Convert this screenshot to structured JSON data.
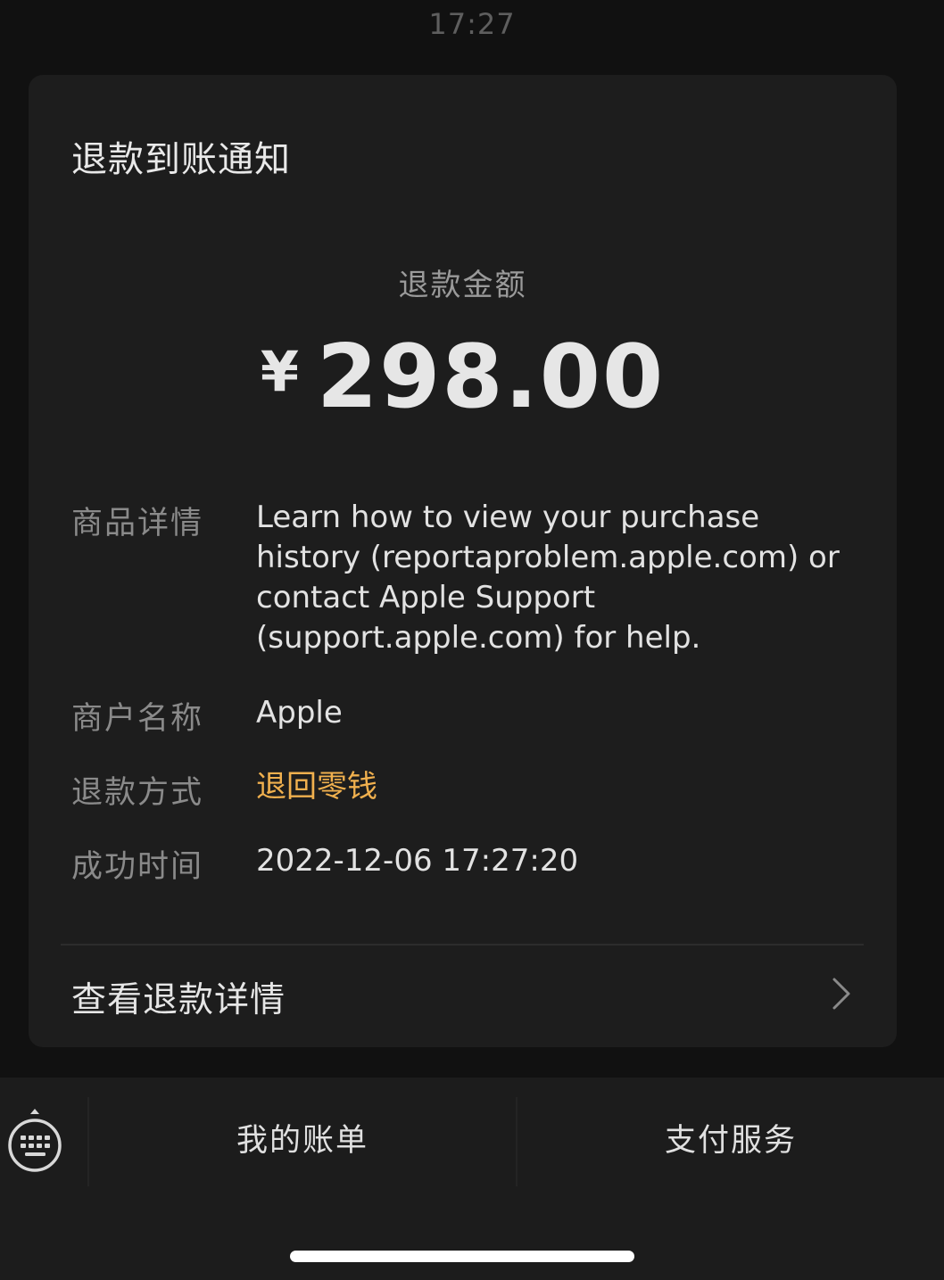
{
  "message": {
    "timestamp": "17:27"
  },
  "card": {
    "title": "退款到账通知",
    "amount_label": "退款金额",
    "currency_symbol": "¥",
    "amount": "298.00",
    "details": [
      {
        "label": "商品详情",
        "value": "Learn how to view your purchase history (reportaproblem.apple.com) or contact Apple Support (support.apple.com) for help."
      },
      {
        "label": "商户名称",
        "value": "Apple"
      },
      {
        "label": "退款方式",
        "value": "退回零钱"
      },
      {
        "label": "成功时间",
        "value": "2022-12-06 17:27:20"
      }
    ],
    "view_detail_label": "查看退款详情",
    "view_detail_icon": "chevron-right-icon"
  },
  "bottom_menu": {
    "keyboard_icon": "keyboard-toggle-icon",
    "items": [
      {
        "label": "我的账单"
      },
      {
        "label": "支付服务"
      }
    ]
  },
  "colors": {
    "accent": "#f0b04e",
    "card_background": "#1d1d1d",
    "page_background": "#111111"
  }
}
